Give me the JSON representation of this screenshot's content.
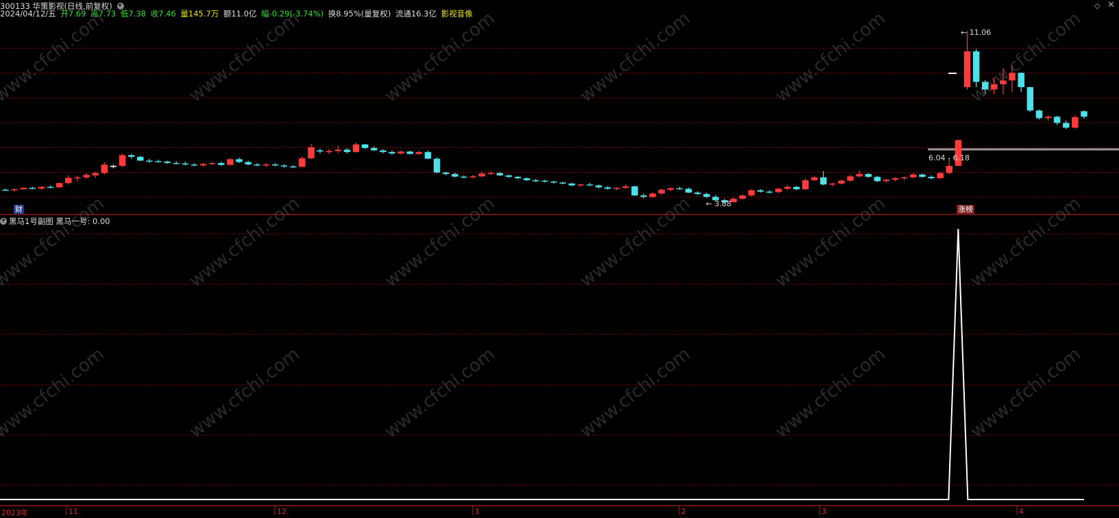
{
  "header": {
    "code_name": "300133 华策影视(日线,前复权)",
    "date": "2024/04/12/五",
    "open": "开7.69",
    "high": "高7.73",
    "low": "低7.38",
    "close": "收7.46",
    "volume": "量145.7万",
    "amount": "额11.0亿",
    "change": "幅-0.29(-3.74%)",
    "turnover": "换8.95%(量复权)",
    "float": "流通16.3亿",
    "sector": "影视音像"
  },
  "icons": {
    "dropdown": "chevron-circle-icon",
    "sub_dropdown": "chevron-circle-icon",
    "diamond": "diamond-icon",
    "close": "close-icon"
  },
  "badges": {
    "cai": "财",
    "zhangbang": "涨榜"
  },
  "annotations": {
    "high_label": "11.06",
    "low_label": "3.88",
    "range_label": "6.04 - 6.18"
  },
  "sub_panel": {
    "title": "黑马1号副图",
    "indicator": "黑马一号: 0.00"
  },
  "x_axis": {
    "labels": [
      "2023年",
      "11",
      "12",
      "1",
      "2",
      "3",
      "4"
    ]
  },
  "colors": {
    "up": "#ff3b3b",
    "down": "#4fe0e8",
    "flat": "#ffffff",
    "grid": "#8b0000",
    "indicator_line": "#ffffff"
  },
  "chart_data": {
    "type": "candlestick",
    "title": "300133 华策影视(日线,前复权)",
    "y_range": [
      3.6,
      11.5
    ],
    "grid_values": [
      4.09,
      5.13,
      6.17,
      7.21,
      8.25,
      9.29,
      10.33
    ],
    "candles": [
      [
        4.4,
        4.45,
        4.35,
        4.38
      ],
      [
        4.38,
        4.45,
        4.32,
        4.42
      ],
      [
        4.42,
        4.5,
        4.4,
        4.48
      ],
      [
        4.48,
        4.52,
        4.42,
        4.45
      ],
      [
        4.45,
        4.55,
        4.4,
        4.52
      ],
      [
        4.52,
        4.58,
        4.46,
        4.5
      ],
      [
        4.5,
        4.7,
        4.48,
        4.68
      ],
      [
        4.68,
        5.0,
        4.62,
        4.9
      ],
      [
        4.9,
        4.98,
        4.75,
        4.92
      ],
      [
        4.92,
        5.1,
        4.85,
        5.02
      ],
      [
        5.0,
        5.15,
        4.9,
        5.1
      ],
      [
        5.1,
        5.55,
        5.05,
        5.45
      ],
      [
        5.4,
        5.45,
        5.3,
        5.4
      ],
      [
        5.4,
        5.9,
        5.35,
        5.85
      ],
      [
        5.85,
        5.9,
        5.7,
        5.78
      ],
      [
        5.78,
        5.82,
        5.6,
        5.62
      ],
      [
        5.62,
        5.7,
        5.52,
        5.6
      ],
      [
        5.6,
        5.66,
        5.54,
        5.58
      ],
      [
        5.58,
        5.62,
        5.48,
        5.52
      ],
      [
        5.52,
        5.6,
        5.46,
        5.5
      ],
      [
        5.5,
        5.58,
        5.42,
        5.46
      ],
      [
        5.46,
        5.52,
        5.38,
        5.42
      ],
      [
        5.42,
        5.52,
        5.36,
        5.48
      ],
      [
        5.48,
        5.56,
        5.42,
        5.52
      ],
      [
        5.52,
        5.58,
        5.4,
        5.44
      ],
      [
        5.44,
        5.72,
        5.42,
        5.68
      ],
      [
        5.68,
        5.74,
        5.52,
        5.56
      ],
      [
        5.56,
        5.62,
        5.42,
        5.46
      ],
      [
        5.46,
        5.52,
        5.38,
        5.42
      ],
      [
        5.42,
        5.5,
        5.36,
        5.46
      ],
      [
        5.46,
        5.52,
        5.38,
        5.42
      ],
      [
        5.42,
        5.46,
        5.32,
        5.38
      ],
      [
        5.38,
        5.42,
        5.3,
        5.36
      ],
      [
        5.36,
        5.8,
        5.34,
        5.72
      ],
      [
        5.72,
        6.32,
        5.68,
        6.18
      ],
      [
        6.05,
        6.12,
        5.92,
        6.0
      ],
      [
        6.0,
        6.1,
        5.9,
        6.02
      ],
      [
        6.02,
        6.25,
        5.94,
        6.08
      ],
      [
        6.08,
        6.15,
        5.92,
        5.98
      ],
      [
        5.98,
        6.38,
        5.96,
        6.3
      ],
      [
        6.3,
        6.32,
        6.1,
        6.15
      ],
      [
        6.15,
        6.22,
        6.02,
        6.05
      ],
      [
        6.05,
        6.1,
        5.92,
        5.98
      ],
      [
        5.98,
        6.04,
        5.86,
        5.92
      ],
      [
        5.92,
        6.04,
        5.88,
        6.0
      ],
      [
        6.0,
        6.04,
        5.88,
        5.9
      ],
      [
        5.9,
        6.02,
        5.86,
        5.98
      ],
      [
        5.98,
        6.04,
        5.68,
        5.7
      ],
      [
        5.7,
        5.76,
        5.08,
        5.12
      ],
      [
        5.12,
        5.16,
        5.0,
        5.06
      ],
      [
        5.06,
        5.12,
        4.92,
        4.95
      ],
      [
        4.95,
        5.0,
        4.88,
        4.92
      ],
      [
        4.92,
        5.02,
        4.88,
        4.96
      ],
      [
        4.96,
        5.16,
        4.92,
        5.08
      ],
      [
        5.08,
        5.18,
        5.02,
        5.1
      ],
      [
        5.1,
        5.14,
        4.98,
        5.0
      ],
      [
        5.0,
        5.04,
        4.9,
        4.94
      ],
      [
        4.94,
        4.98,
        4.84,
        4.88
      ],
      [
        4.88,
        4.92,
        4.76,
        4.8
      ],
      [
        4.8,
        4.86,
        4.72,
        4.78
      ],
      [
        4.78,
        4.82,
        4.7,
        4.74
      ],
      [
        4.74,
        4.78,
        4.66,
        4.7
      ],
      [
        4.7,
        4.74,
        4.62,
        4.66
      ],
      [
        4.66,
        4.7,
        4.55,
        4.58
      ],
      [
        4.58,
        4.66,
        4.52,
        4.62
      ],
      [
        4.62,
        4.68,
        4.56,
        4.58
      ],
      [
        4.58,
        4.62,
        4.46,
        4.5
      ],
      [
        4.5,
        4.56,
        4.4,
        4.44
      ],
      [
        4.44,
        4.52,
        4.38,
        4.48
      ],
      [
        4.48,
        4.62,
        4.42,
        4.54
      ],
      [
        4.54,
        4.58,
        4.14,
        4.16
      ],
      [
        4.16,
        4.24,
        4.04,
        4.1
      ],
      [
        4.1,
        4.28,
        4.06,
        4.24
      ],
      [
        4.24,
        4.44,
        4.2,
        4.4
      ],
      [
        4.4,
        4.5,
        4.34,
        4.46
      ],
      [
        4.46,
        4.52,
        4.4,
        4.44
      ],
      [
        4.44,
        4.5,
        4.26,
        4.28
      ],
      [
        4.28,
        4.34,
        4.18,
        4.22
      ],
      [
        4.22,
        4.28,
        4.06,
        4.1
      ],
      [
        4.1,
        4.18,
        3.92,
        3.96
      ],
      [
        3.96,
        4.02,
        3.84,
        3.88
      ],
      [
        3.88,
        4.08,
        3.86,
        4.02
      ],
      [
        4.02,
        4.2,
        3.98,
        4.16
      ],
      [
        4.16,
        4.42,
        4.12,
        4.38
      ],
      [
        4.38,
        4.42,
        4.28,
        4.32
      ],
      [
        4.32,
        4.38,
        4.24,
        4.3
      ],
      [
        4.3,
        4.48,
        4.26,
        4.44
      ],
      [
        4.44,
        4.6,
        4.4,
        4.52
      ],
      [
        4.52,
        4.56,
        4.38,
        4.42
      ],
      [
        4.42,
        4.88,
        4.38,
        4.8
      ],
      [
        4.8,
        4.96,
        4.78,
        4.92
      ],
      [
        4.92,
        5.18,
        4.58,
        4.62
      ],
      [
        4.62,
        4.7,
        4.54,
        4.66
      ],
      [
        4.66,
        4.82,
        4.62,
        4.78
      ],
      [
        4.78,
        5.02,
        4.74,
        4.96
      ],
      [
        4.96,
        5.2,
        4.92,
        5.06
      ],
      [
        5.06,
        5.1,
        4.9,
        4.94
      ],
      [
        4.94,
        4.98,
        4.72,
        4.76
      ],
      [
        4.76,
        4.86,
        4.7,
        4.82
      ],
      [
        4.82,
        4.92,
        4.76,
        4.88
      ],
      [
        4.88,
        4.96,
        4.8,
        4.92
      ],
      [
        4.92,
        5.1,
        4.88,
        5.04
      ],
      [
        5.04,
        5.08,
        4.9,
        4.94
      ],
      [
        4.94,
        5.0,
        4.84,
        4.88
      ],
      [
        4.88,
        5.14,
        4.86,
        5.1
      ],
      [
        5.1,
        5.72,
        5.04,
        5.4
      ],
      [
        5.4,
        6.5,
        5.38,
        6.48
      ],
      [
        8.7,
        11.06,
        8.6,
        10.2
      ],
      [
        10.2,
        10.3,
        8.7,
        8.92
      ],
      [
        8.92,
        9.0,
        8.4,
        8.6
      ],
      [
        8.6,
        9.1,
        8.4,
        8.82
      ],
      [
        8.82,
        9.5,
        8.4,
        8.98
      ],
      [
        8.98,
        9.6,
        8.5,
        9.3
      ],
      [
        9.3,
        9.32,
        8.5,
        8.7
      ],
      [
        8.7,
        8.72,
        7.66,
        7.72
      ],
      [
        7.72,
        7.76,
        7.34,
        7.4
      ],
      [
        7.4,
        7.52,
        7.3,
        7.46
      ],
      [
        7.46,
        7.5,
        7.12,
        7.2
      ],
      [
        7.2,
        7.3,
        6.94,
        7.0
      ],
      [
        7.0,
        7.52,
        6.96,
        7.44
      ],
      [
        7.69,
        7.73,
        7.38,
        7.46
      ]
    ],
    "x_labels": [
      "2023年",
      "11",
      "12",
      "1",
      "2",
      "3",
      "4"
    ],
    "sub_series": {
      "name": "黑马一号",
      "values_note": "zero everywhere except a single spike",
      "baseline": 0,
      "spike_value": 1,
      "spike_index": 106
    }
  }
}
